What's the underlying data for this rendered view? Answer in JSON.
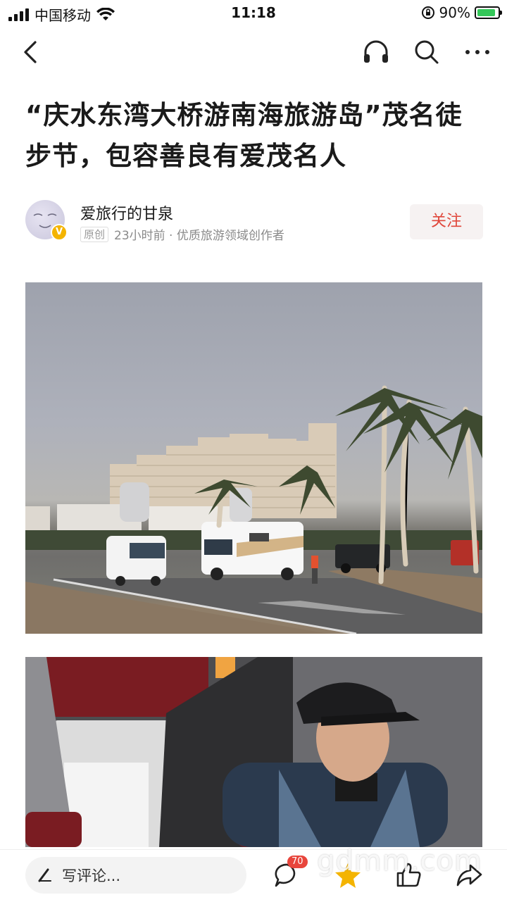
{
  "status_bar": {
    "carrier": "中国移动",
    "time": "11:18",
    "battery_percent": "90%",
    "battery_level": 0.9
  },
  "nav": {
    "back_icon": "chevron-left-icon",
    "icons": [
      "headphones-icon",
      "search-icon",
      "more-icon"
    ]
  },
  "article": {
    "title": "“庆水东湾大桥游南海旅游岛”茂名徒步节，包容善良有爱茂名人"
  },
  "author": {
    "name": "爱旅行的甘泉",
    "original_badge": "原创",
    "meta": "23小时前 · 优质旅游领域创作者",
    "verified_mark": "V",
    "follow_label": "关注"
  },
  "bottom_bar": {
    "comment_placeholder": "写评论...",
    "comment_count": "70",
    "icons": [
      "comment-icon",
      "favorite-star-icon",
      "like-icon",
      "share-icon"
    ],
    "accent": "#f4b400"
  },
  "watermark": "gdmm.com",
  "colors": {
    "follow_text": "#e0473b",
    "badge_bg": "#e8453c"
  }
}
